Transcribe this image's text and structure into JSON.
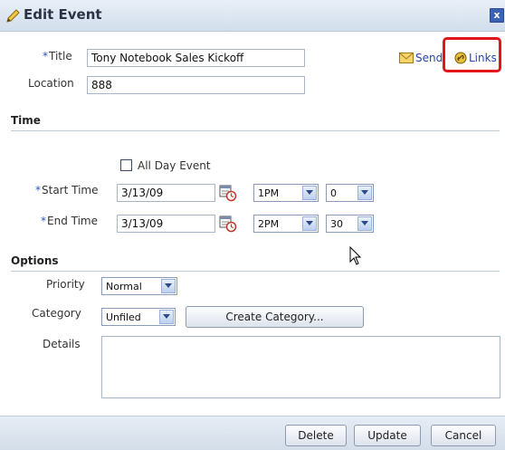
{
  "dialog": {
    "title": "Edit Event",
    "close_label": "x",
    "title_icon": "pencil-icon"
  },
  "actions": {
    "send_label": "Send",
    "send_icon": "envelope-icon",
    "links_label": "Links",
    "links_icon": "link-icon",
    "highlight_color": "#e3141b"
  },
  "fields": {
    "title_label": "Title",
    "title_value": "Tony Notebook Sales Kickoff",
    "location_label": "Location",
    "location_value": "888",
    "required_marker": "*"
  },
  "time": {
    "section_label": "Time",
    "all_day_label": "All Day Event",
    "all_day_checked": false,
    "start_label": "Start Time",
    "start_date": "3/13/09",
    "start_hour": "1PM",
    "start_minute": "0",
    "end_label": "End Time",
    "end_date": "3/13/09",
    "end_hour": "2PM",
    "end_minute": "30",
    "calendar_icon": "calendar-clock-icon"
  },
  "options": {
    "section_label": "Options",
    "priority_label": "Priority",
    "priority_value": "Normal",
    "category_label": "Category",
    "category_value": "Unfiled",
    "create_category_label": "Create Category...",
    "details_label": "Details",
    "details_value": ""
  },
  "footer": {
    "delete_label": "Delete",
    "update_label": "Update",
    "cancel_label": "Cancel"
  },
  "colors": {
    "accent": "#3b63b4",
    "link": "#2a44a8",
    "required": "#2a55b6"
  }
}
